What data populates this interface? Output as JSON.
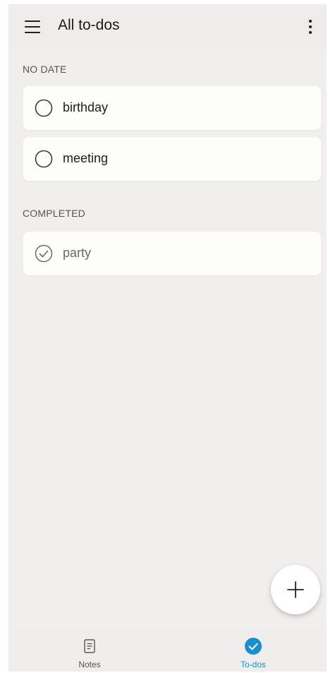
{
  "app_bar": {
    "title": "All to-dos",
    "menu_icon": "hamburger-menu-icon",
    "more_icon": "more-vertical-icon"
  },
  "sections": {
    "no_date": {
      "label": "NO DATE",
      "items": [
        {
          "text": "birthday",
          "completed": false
        },
        {
          "text": "meeting",
          "completed": false
        }
      ]
    },
    "completed": {
      "label": "COMPLETED",
      "items": [
        {
          "text": "party",
          "completed": true
        }
      ]
    }
  },
  "fab": {
    "icon": "plus-icon"
  },
  "bottom_nav": {
    "items": [
      {
        "label": "Notes",
        "icon": "notes-icon",
        "active": false
      },
      {
        "label": "To-dos",
        "icon": "check-circle-icon",
        "active": true
      }
    ]
  },
  "colors": {
    "accent": "#1b8fce",
    "background": "#f1efed",
    "card": "#fdfdfc"
  }
}
